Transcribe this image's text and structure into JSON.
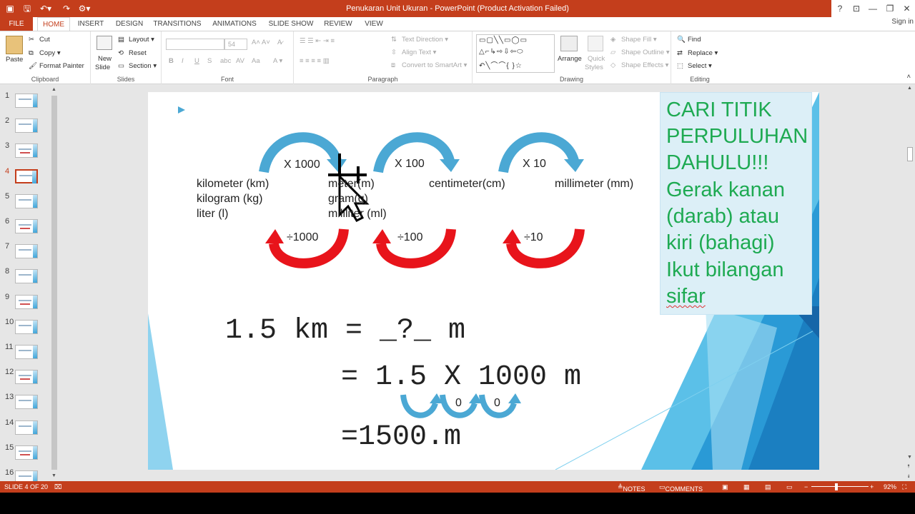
{
  "window": {
    "title": "Penukaran Unit Ukuran - PowerPoint (Product Activation Failed)",
    "help": "?",
    "sign_in": "Sign in"
  },
  "tabs": [
    "FILE",
    "HOME",
    "INSERT",
    "DESIGN",
    "TRANSITIONS",
    "ANIMATIONS",
    "SLIDE SHOW",
    "REVIEW",
    "VIEW"
  ],
  "active_tab": "HOME",
  "ribbon": {
    "clipboard": {
      "paste": "Paste",
      "cut": "Cut",
      "copy": "Copy",
      "format_painter": "Format Painter",
      "label": "Clipboard"
    },
    "slides": {
      "new_slide_1": "New",
      "new_slide_2": "Slide",
      "layout": "Layout",
      "reset": "Reset",
      "section": "Section",
      "label": "Slides"
    },
    "font": {
      "size": "54",
      "label": "Font"
    },
    "paragraph": {
      "text_direction": "Text Direction",
      "align_text": "Align Text",
      "convert_smartart": "Convert to SmartArt",
      "label": "Paragraph"
    },
    "drawing": {
      "arrange": "Arrange",
      "quick_styles_1": "Quick",
      "quick_styles_2": "Styles",
      "shape_fill": "Shape Fill",
      "shape_outline": "Shape Outline",
      "shape_effects": "Shape Effects",
      "label": "Drawing"
    },
    "editing": {
      "find": "Find",
      "replace": "Replace",
      "select": "Select",
      "label": "Editing"
    }
  },
  "thumbnails": [
    "1",
    "2",
    "3",
    "4",
    "5",
    "6",
    "7",
    "8",
    "9",
    "10",
    "11",
    "12",
    "13",
    "14",
    "15",
    "16"
  ],
  "active_slide": 4,
  "slide": {
    "mult_arrows": [
      "X 1000",
      "X 100",
      "X 10"
    ],
    "div_arrows": [
      "÷1000",
      "÷100",
      "÷10"
    ],
    "units_col1": [
      "kilometer (km)",
      "kilogram (kg)",
      "liter (l)"
    ],
    "units_col2": [
      "meter(m)",
      "gram(g)",
      "mililiter (ml)"
    ],
    "unit_cm": "centimeter(cm)",
    "unit_mm": "millimeter (mm)",
    "eq1": "1.5 km = _?_ m",
    "eq2": "= 1.5  X  1000 m",
    "eq3": "=1500.m",
    "zero1": "0",
    "zero2": "0",
    "note_lines": [
      "CARI TITIK",
      "PERPULUHAN",
      "DAHULU!!!",
      "Gerak kanan",
      "(darab) atau",
      "kiri (bahagi)",
      "Ikut bilangan",
      "sifar"
    ]
  },
  "status": {
    "slide_info": "SLIDE 4 OF 20",
    "notes": "NOTES",
    "comments": "COMMENTS",
    "zoom": "92%"
  },
  "colors": {
    "brand": "#c43e1c",
    "blue_arrow": "#4ba8d4",
    "red_arrow": "#e8141b",
    "note_text": "#1eaa52",
    "note_bg": "#dceff7"
  }
}
